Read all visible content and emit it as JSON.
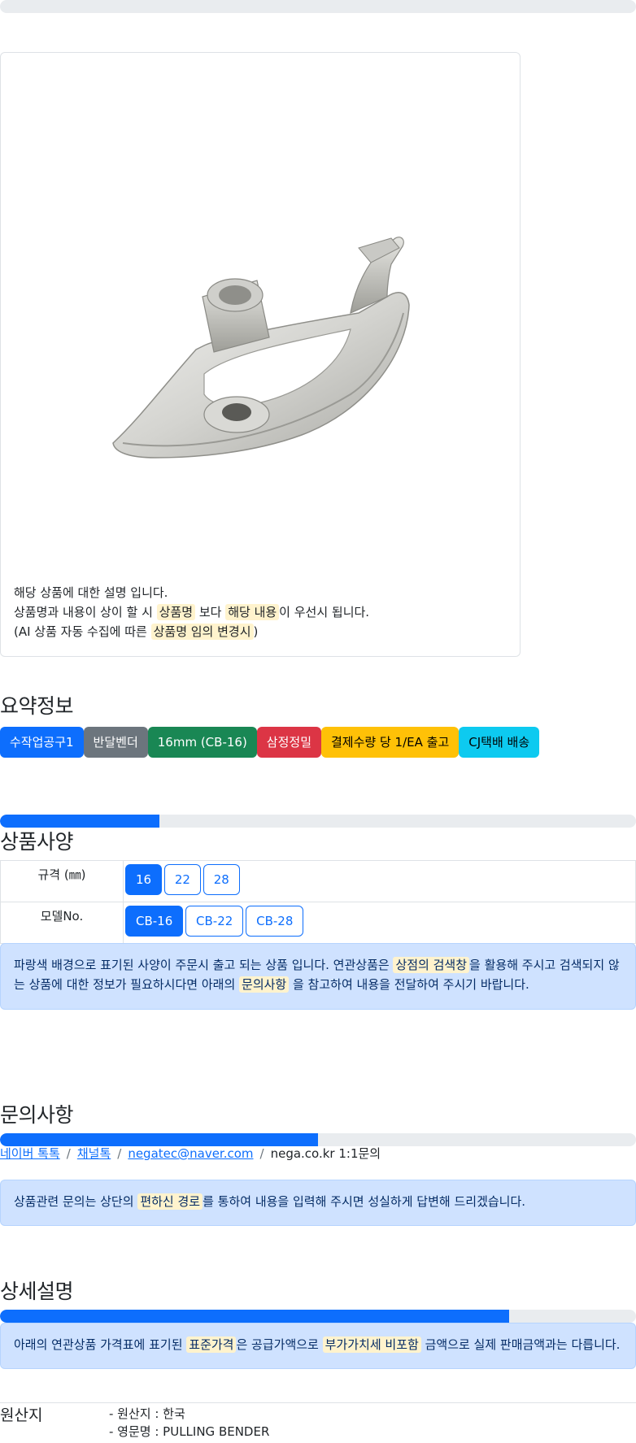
{
  "description": {
    "line1": "해당 상품에 대한 설명 입니다.",
    "line2_a": "상품명과 내용이 상이 할 시 ",
    "line2_hl1": "상품명",
    "line2_b": " 보다 ",
    "line2_hl2": "해당 내용",
    "line2_c": "이 우선시 됩니다.",
    "line3_a": "(AI 상품 자동 수집에 따른 ",
    "line3_hl": "상품명 임의 변경시",
    "line3_b": ")"
  },
  "summary": {
    "title": "요약정보",
    "badges": [
      "수작업공구1",
      "반달벤더",
      "16mm (CB-16)",
      "삼정정밀",
      "결제수량 당 1/EA 출고",
      "CJ택배 배송"
    ]
  },
  "specs": {
    "title": "상품사양",
    "progress": 0.25,
    "rows": [
      {
        "label": "규격 (㎜)",
        "options": [
          "16",
          "22",
          "28"
        ],
        "selected": "16"
      },
      {
        "label": "모델No.",
        "options": [
          "CB-16",
          "CB-22",
          "CB-28"
        ],
        "selected": "CB-16"
      }
    ],
    "notice_a": "파랑색 배경으로 표기된 사양이 주문시 출고 되는 상품 입니다. 연관상품은 ",
    "notice_hl1": "상점의 검색창",
    "notice_b": "을 활용해 주시고 검색되지 않는 상품에 대한 정보가 필요하시다면 아래의 ",
    "notice_hl2": "문의사항",
    "notice_c": " 을 참고하여 내용을 전달하여 주시기 바랍니다."
  },
  "inquiry": {
    "title": "문의사항",
    "progress": 0.5,
    "links": [
      "네이버 톡톡",
      "채널톡",
      "negatec@naver.com"
    ],
    "plain": "nega.co.kr 1:1문의",
    "separator": "/",
    "notice_a": "상품관련 문의는 상단의 ",
    "notice_hl": "편하신 경로",
    "notice_b": "를 통하여 내용을 입력해 주시면 성실하게 답변해 드리겠습니다."
  },
  "detail": {
    "title": "상세설명",
    "progress": 0.8,
    "notice_a": "아래의 연관상품 가격표에 표기된 ",
    "notice_hl1": "표준가격",
    "notice_b": "은 공급가액으로 ",
    "notice_hl2": "부가가치세 비포함",
    "notice_c": " 금액으로 실제 판매금액과는 다릅니다."
  },
  "origin": {
    "label": "원산지",
    "items": [
      "- 원산지 : 한국",
      "- 영문명 : PULLING BENDER"
    ]
  },
  "colors": {
    "primary": "#0d6efd",
    "alert_bg": "#cfe2ff",
    "highlight": "#fff3cd"
  }
}
